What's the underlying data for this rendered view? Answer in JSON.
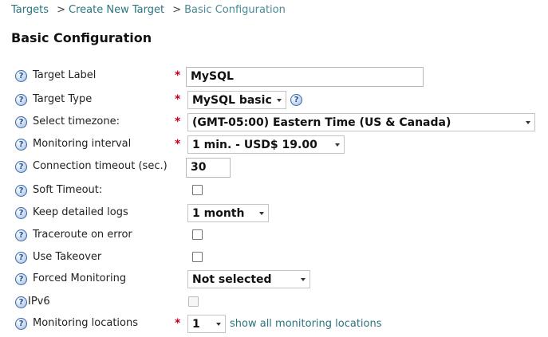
{
  "breadcrumb": {
    "items": [
      {
        "label": "Targets"
      },
      {
        "sep": ">",
        "label": "Create New Target"
      },
      {
        "sep": ">",
        "label": "Basic Configuration"
      }
    ]
  },
  "page": {
    "title": "Basic Configuration"
  },
  "help_icon_glyph": "?",
  "required_marker": "*",
  "fields": {
    "target_label": {
      "label": "Target Label",
      "value": "MySQL"
    },
    "target_type": {
      "label": "Target Type",
      "value": "MySQL basic"
    },
    "timezone": {
      "label": "Select timezone:",
      "value": "(GMT-05:00) Eastern Time (US & Canada)"
    },
    "monitoring_interval": {
      "label": "Monitoring interval",
      "value": "1 min. - USD$ 19.00"
    },
    "connection_timeout": {
      "label": "Connection timeout (sec.)",
      "value": "30"
    },
    "soft_timeout": {
      "label": "Soft Timeout:",
      "checked": false
    },
    "detailed_logs": {
      "label": "Keep detailed logs",
      "value": "1 month"
    },
    "traceroute": {
      "label": "Traceroute on error",
      "checked": false
    },
    "takeover": {
      "label": "Use Takeover",
      "checked": false
    },
    "forced_monitoring": {
      "label": "Forced Monitoring",
      "value": "Not selected"
    },
    "ipv6": {
      "label": "IPv6",
      "checked": false,
      "disabled": true
    },
    "monitoring_locations": {
      "label": "Monitoring locations",
      "value": "1",
      "link": "show all monitoring locations"
    }
  },
  "colors": {
    "link": "#2a7480",
    "required": "#c0001b",
    "help_icon": "#3e6aa8"
  }
}
